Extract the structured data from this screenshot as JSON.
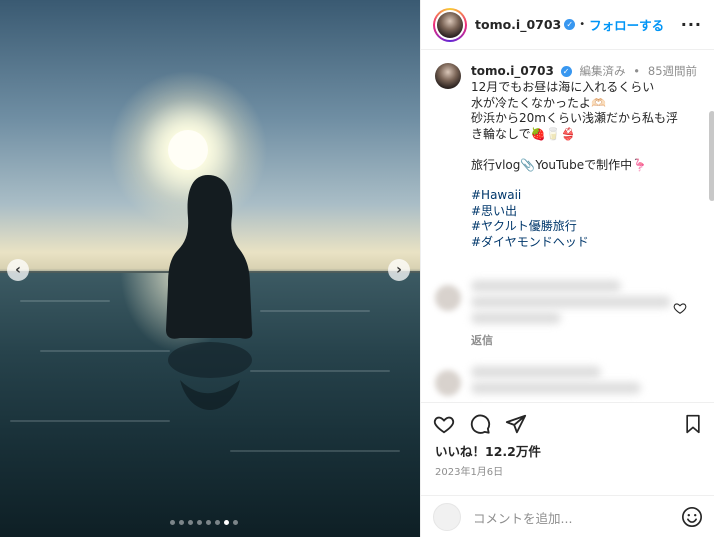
{
  "post": {
    "username": "tomo.i_0703",
    "follow_label": "フォローする",
    "bullet": "•",
    "edited": "編集済み",
    "time_ago": "85週間前",
    "caption_lines": "12月でもお昼は海に入れるくらい\n水が冷たくなかったよ🫶🏻\n砂浜から20mくらい浅瀬だから私も浮\nき輪なしで🍓🥛👙\n\n旅行vlog📎YouTubeで制作中🦩",
    "hashtags": [
      "#Hawaii",
      "#思い出",
      "#ヤクルト優勝旅行",
      "#ダイヤモンドヘッド"
    ],
    "reply_label": "返信",
    "likes": "いいね！12.2万件",
    "date": "2023年1月6日",
    "comment_placeholder": "コメントを追加...",
    "carousel": {
      "total": 8,
      "active_index": 6
    }
  },
  "colors": {
    "accent": "#0095f6",
    "verified": "#3897f0",
    "hashtag": "#00376b",
    "muted": "#8e8e8e"
  },
  "icons": {
    "more": "more-icon",
    "heart": "heart-icon",
    "comment": "comment-icon",
    "share": "share-icon",
    "save": "bookmark-icon",
    "emoji": "emoji-icon"
  }
}
